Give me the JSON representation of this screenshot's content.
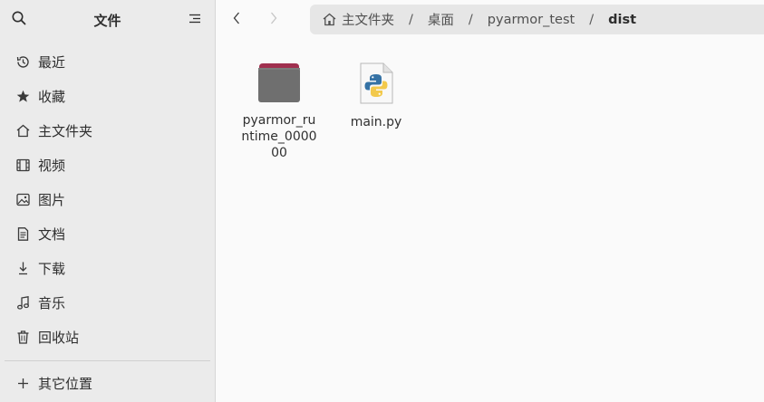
{
  "sidebar": {
    "title": "文件",
    "items": [
      {
        "label": "最近",
        "icon": "clock-icon"
      },
      {
        "label": "收藏",
        "icon": "star-icon"
      },
      {
        "label": "主文件夹",
        "icon": "home-icon"
      },
      {
        "label": "视频",
        "icon": "video-icon"
      },
      {
        "label": "图片",
        "icon": "image-icon"
      },
      {
        "label": "文档",
        "icon": "document-icon"
      },
      {
        "label": "下载",
        "icon": "download-icon"
      },
      {
        "label": "音乐",
        "icon": "music-icon"
      },
      {
        "label": "回收站",
        "icon": "trash-icon"
      }
    ],
    "other_locations": {
      "label": "其它位置",
      "icon": "plus-icon"
    }
  },
  "nav": {
    "back_icon": "chevron-left-icon",
    "forward_icon": "chevron-right-icon"
  },
  "pathbar": {
    "crumbs": [
      "主文件夹",
      "桌面",
      "pyarmor_test",
      "dist"
    ],
    "separator": "/"
  },
  "files": [
    {
      "name": "pyarmor_runtime_000000",
      "type": "folder",
      "icon": "folder-icon"
    },
    {
      "name": "main.py",
      "type": "python",
      "icon": "python-file-icon"
    }
  ],
  "colors": {
    "sidebar_bg": "#ebebeb",
    "main_bg": "#fafafa",
    "folder_body": "#6f6f6f",
    "folder_tab": "#a0304f"
  }
}
